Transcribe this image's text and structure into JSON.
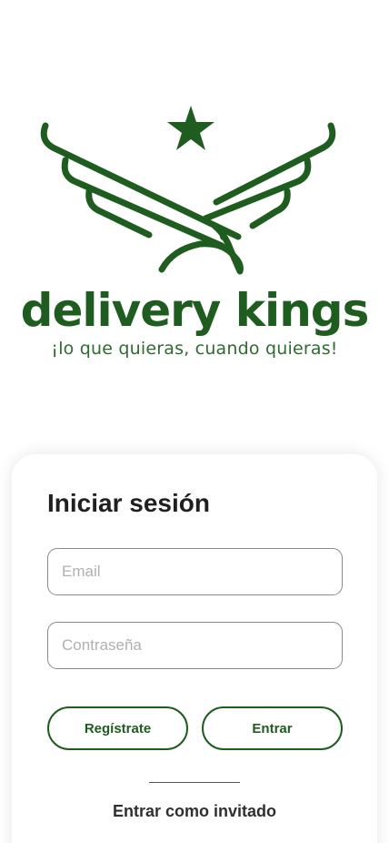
{
  "brand": {
    "name": "delivery kings",
    "tagline": "¡lo que quieras, cuando quieras!",
    "color": "#1f5c1f"
  },
  "login": {
    "title": "Iniciar sesión",
    "email_placeholder": "Email",
    "password_placeholder": "Contraseña",
    "register_label": "Regístrate",
    "enter_label": "Entrar",
    "guest_label": "Entrar como invitado"
  }
}
